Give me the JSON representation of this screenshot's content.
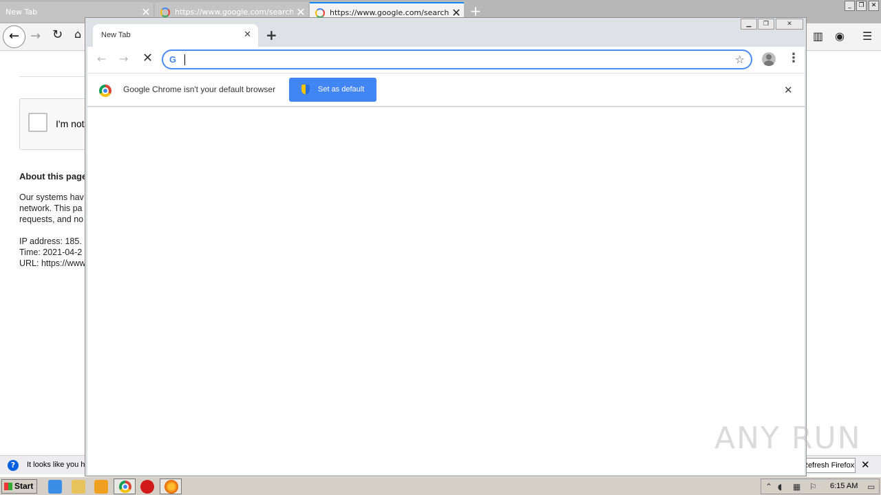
{
  "firefox": {
    "tabs": [
      {
        "title": "New Tab"
      },
      {
        "title": "https://www.google.com/search?"
      },
      {
        "title": "https://www.google.com/search?q"
      }
    ],
    "captcha_label": "I'm not",
    "about_heading": "About this page",
    "about_lines": [
      "Our systems hav",
      "network. This pa",
      "requests, and no"
    ],
    "info_lines": [
      "IP address: 185.",
      "Time: 2021-04-2",
      "URL: https://www"
    ],
    "notification": {
      "message": "It looks like you h",
      "refresh_label": "Refresh Firefox..."
    }
  },
  "chrome": {
    "tab_title": "New Tab",
    "omnibox_value": "",
    "infobar_message": "Google Chrome isn't your default browser",
    "set_default_label": "Set as default"
  },
  "watermark": "ANY RUN",
  "taskbar": {
    "start_label": "Start",
    "clock": "6:15 AM"
  }
}
